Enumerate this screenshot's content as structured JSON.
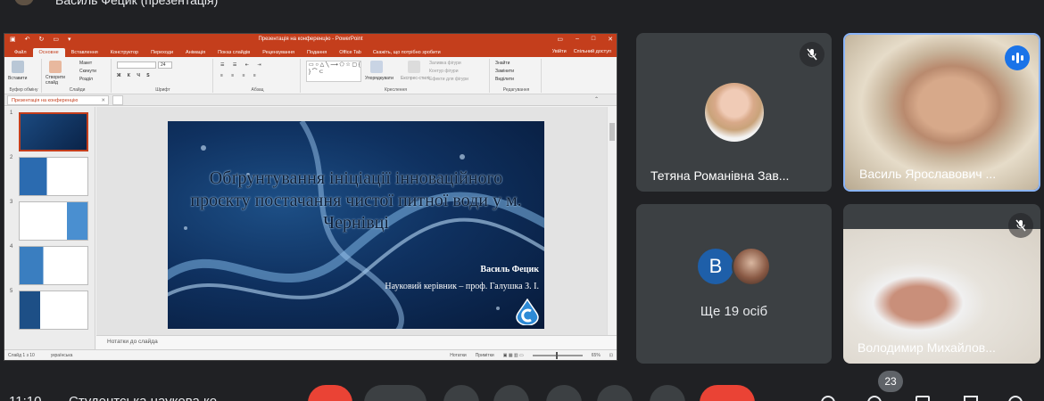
{
  "top": {
    "presenter_name": "Василь Фецик (презентація)"
  },
  "powerpoint": {
    "window_title": "Презентація на конференцію - PowerPoint",
    "tabs": [
      "Файл",
      "Основне",
      "Вставлення",
      "Конструктор",
      "Переходи",
      "Анімація",
      "Показ слайдів",
      "Рецензування",
      "Подання",
      "Office Tab"
    ],
    "active_tab": "Основне",
    "tell_me": "Скажіть, що потрібно зробити",
    "user": "Увійти",
    "share": "Спільний доступ",
    "ribbon": {
      "paste": "Вставити",
      "clipboard": "Буфер обміну",
      "new_slide": "Створити слайд",
      "layout": "Макет",
      "reset": "Скинути",
      "section": "Розділ",
      "slides_group": "Слайди",
      "font_group": "Шрифт",
      "font_size": "24",
      "paragraph_group": "Абзац",
      "arrange": "Упорядкувати",
      "quick_styles": "Експрес-стилі",
      "shape_fill": "Заливка фігури",
      "shape_outline": "Контур фігури",
      "shape_effects": "Ефекти для фігури",
      "drawing_group": "Креслення",
      "find": "Знайти",
      "replace": "Замінити",
      "select": "Виділити",
      "editing_group": "Редагування"
    },
    "document_tab": "Презентація на конференцію",
    "thumb_numbers": [
      "1",
      "2",
      "3",
      "4",
      "5"
    ],
    "slide": {
      "title": "Обґрунтування ініціації інноваційного проєкту постачання чистої питної води у м. Чернівці",
      "author": "Василь Фецик",
      "supervisor": "Науковий керівник – проф. Галушка З. І."
    },
    "notes_placeholder": "Нотатки до слайда",
    "status": {
      "slide_counter": "Слайд 1 з 10",
      "language": "українська",
      "notes": "Нотатки",
      "comments": "Примітки",
      "zoom": "65%"
    }
  },
  "participants": [
    {
      "name": "Тетяна Романівна Зав...",
      "muted": true
    },
    {
      "name": "Василь Ярославович ...",
      "speaking": true
    },
    {
      "more_initial": "В",
      "more_label": "Ще 19 осіб"
    },
    {
      "name": "Володимир Михайлов...",
      "muted": true
    }
  ],
  "bottom_bar": {
    "time": "11:10",
    "meeting_name": "Студентська наукова ко...",
    "participant_count": "23"
  },
  "colors": {
    "ppt_accent": "#c43e1c",
    "meet_bg": "#202124",
    "tile_bg": "#3c4043",
    "speaking_blue": "#1a73e8",
    "end_call_red": "#ea4335"
  }
}
